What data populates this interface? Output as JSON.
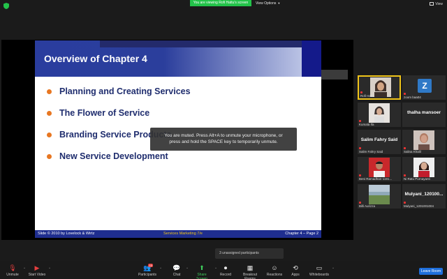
{
  "topbar": {
    "banner": "You are viewing Rofi Hattu's screen",
    "view_options": "View Options",
    "view": "View"
  },
  "slide": {
    "title": "Overview of Chapter 4",
    "bullets": [
      "Planning and Creating Services",
      "The Flower of Service",
      "Branding Service Products",
      "New Service Development"
    ],
    "footer_left": "Slide © 2010 by Lovelock & Wirtz",
    "footer_center": "Services Marketing 7/e",
    "footer_right": "Chapter 4 – Page 2",
    "bullet_color": "#e87722",
    "text_color": "#1f2d6e"
  },
  "toast": {
    "line1": "You are muted. Press Alt+A to unmute your microphone, or",
    "line2": "press and hold the SPACE key to temporarily unmute."
  },
  "gallery": {
    "t1_name": "Rofi Hattu",
    "t2_letter": "Z",
    "t2_name": "zoom baa04",
    "t3_name": "Kumala Ifa",
    "t4_big": "thalha mansoer",
    "t5_big": "Salim Fahry Said",
    "t5_name": "Salim Fahry Said",
    "t6_name": "Salina Khalil",
    "t7_name": "Beni Ramadhan-1191...",
    "t8_name": "Ni Ratu Purnayanti",
    "t9_name": "Billi Aurizza",
    "t10_big": "Mulyani_120100...",
    "t10_name": "Mulyani_1201001004"
  },
  "unassigned": "3 unassigned participants",
  "toolbar": {
    "unmute": "Unmute",
    "start_video": "Start Video",
    "participants": "Participants",
    "participants_count": "15",
    "chat": "Chat",
    "share_screen": "Share Screen",
    "record": "Record",
    "breakout": "Breakout Rooms",
    "reactions": "Reactions",
    "apps": "Apps",
    "whiteboards": "Whiteboards",
    "leave": "Leave Room"
  }
}
